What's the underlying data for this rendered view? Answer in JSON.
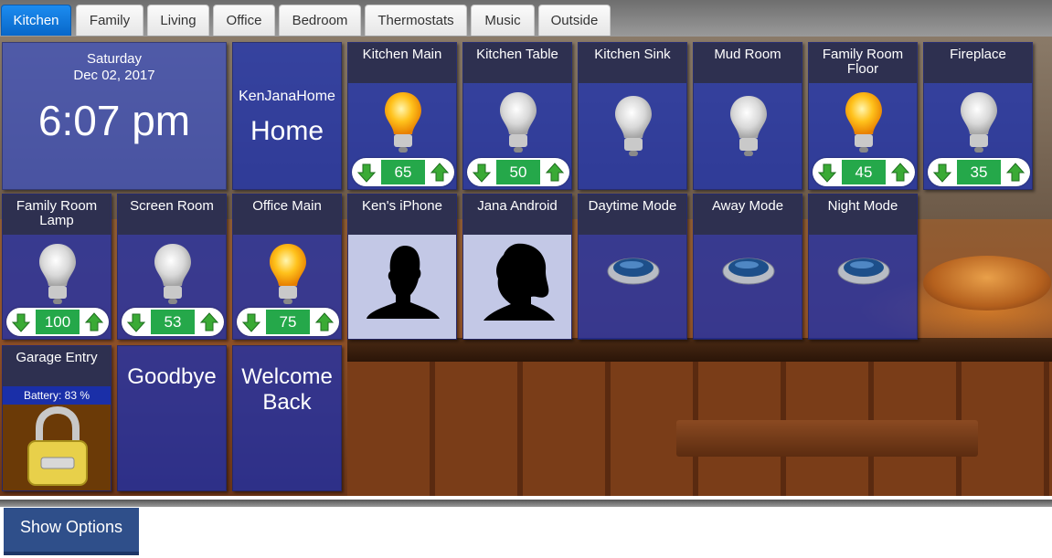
{
  "tabs": [
    {
      "label": "Kitchen",
      "active": true
    },
    {
      "label": "Family",
      "active": false
    },
    {
      "label": "Living",
      "active": false
    },
    {
      "label": "Office",
      "active": false
    },
    {
      "label": "Bedroom",
      "active": false
    },
    {
      "label": "Thermostats",
      "active": false
    },
    {
      "label": "Music",
      "active": false
    },
    {
      "label": "Outside",
      "active": false
    }
  ],
  "clock": {
    "day": "Saturday",
    "date": "Dec 02, 2017",
    "time": "6:07 pm"
  },
  "mode": {
    "hub_name": "KenJanaHome",
    "current": "Home"
  },
  "dimmers": [
    {
      "name": "Kitchen Main",
      "state": "on",
      "level": "65"
    },
    {
      "name": "Kitchen Table",
      "state": "off",
      "level": "50"
    },
    {
      "name": "Family Room Floor",
      "state": "on",
      "level": "45"
    },
    {
      "name": "Fireplace",
      "state": "off",
      "level": "35"
    },
    {
      "name": "Family Room Lamp",
      "state": "off",
      "level": "100"
    },
    {
      "name": "Screen Room",
      "state": "off",
      "level": "53"
    },
    {
      "name": "Office Main",
      "state": "on",
      "level": "75"
    }
  ],
  "switches": [
    {
      "name": "Kitchen Sink",
      "state": "off"
    },
    {
      "name": "Mud Room",
      "state": "off"
    }
  ],
  "presence": [
    {
      "name": "Ken's iPhone",
      "icon": "male-silhouette-icon"
    },
    {
      "name": "Jana Android",
      "icon": "female-silhouette-icon"
    }
  ],
  "modes_buttons": [
    {
      "name": "Daytime Mode"
    },
    {
      "name": "Away Mode"
    },
    {
      "name": "Night Mode"
    }
  ],
  "lock": {
    "name": "Garage Entry",
    "battery": "Battery: 83 %",
    "state": "locked"
  },
  "routines": [
    {
      "label": "Goodbye"
    },
    {
      "label": "Welcome Back"
    }
  ],
  "footer": {
    "show_options_label": "Show Options"
  },
  "colors": {
    "tile_bg": "#162eb4",
    "tile_header": "#2e3050",
    "dimmer_value": "#25a84a",
    "active_tab": "#0a75dd"
  }
}
